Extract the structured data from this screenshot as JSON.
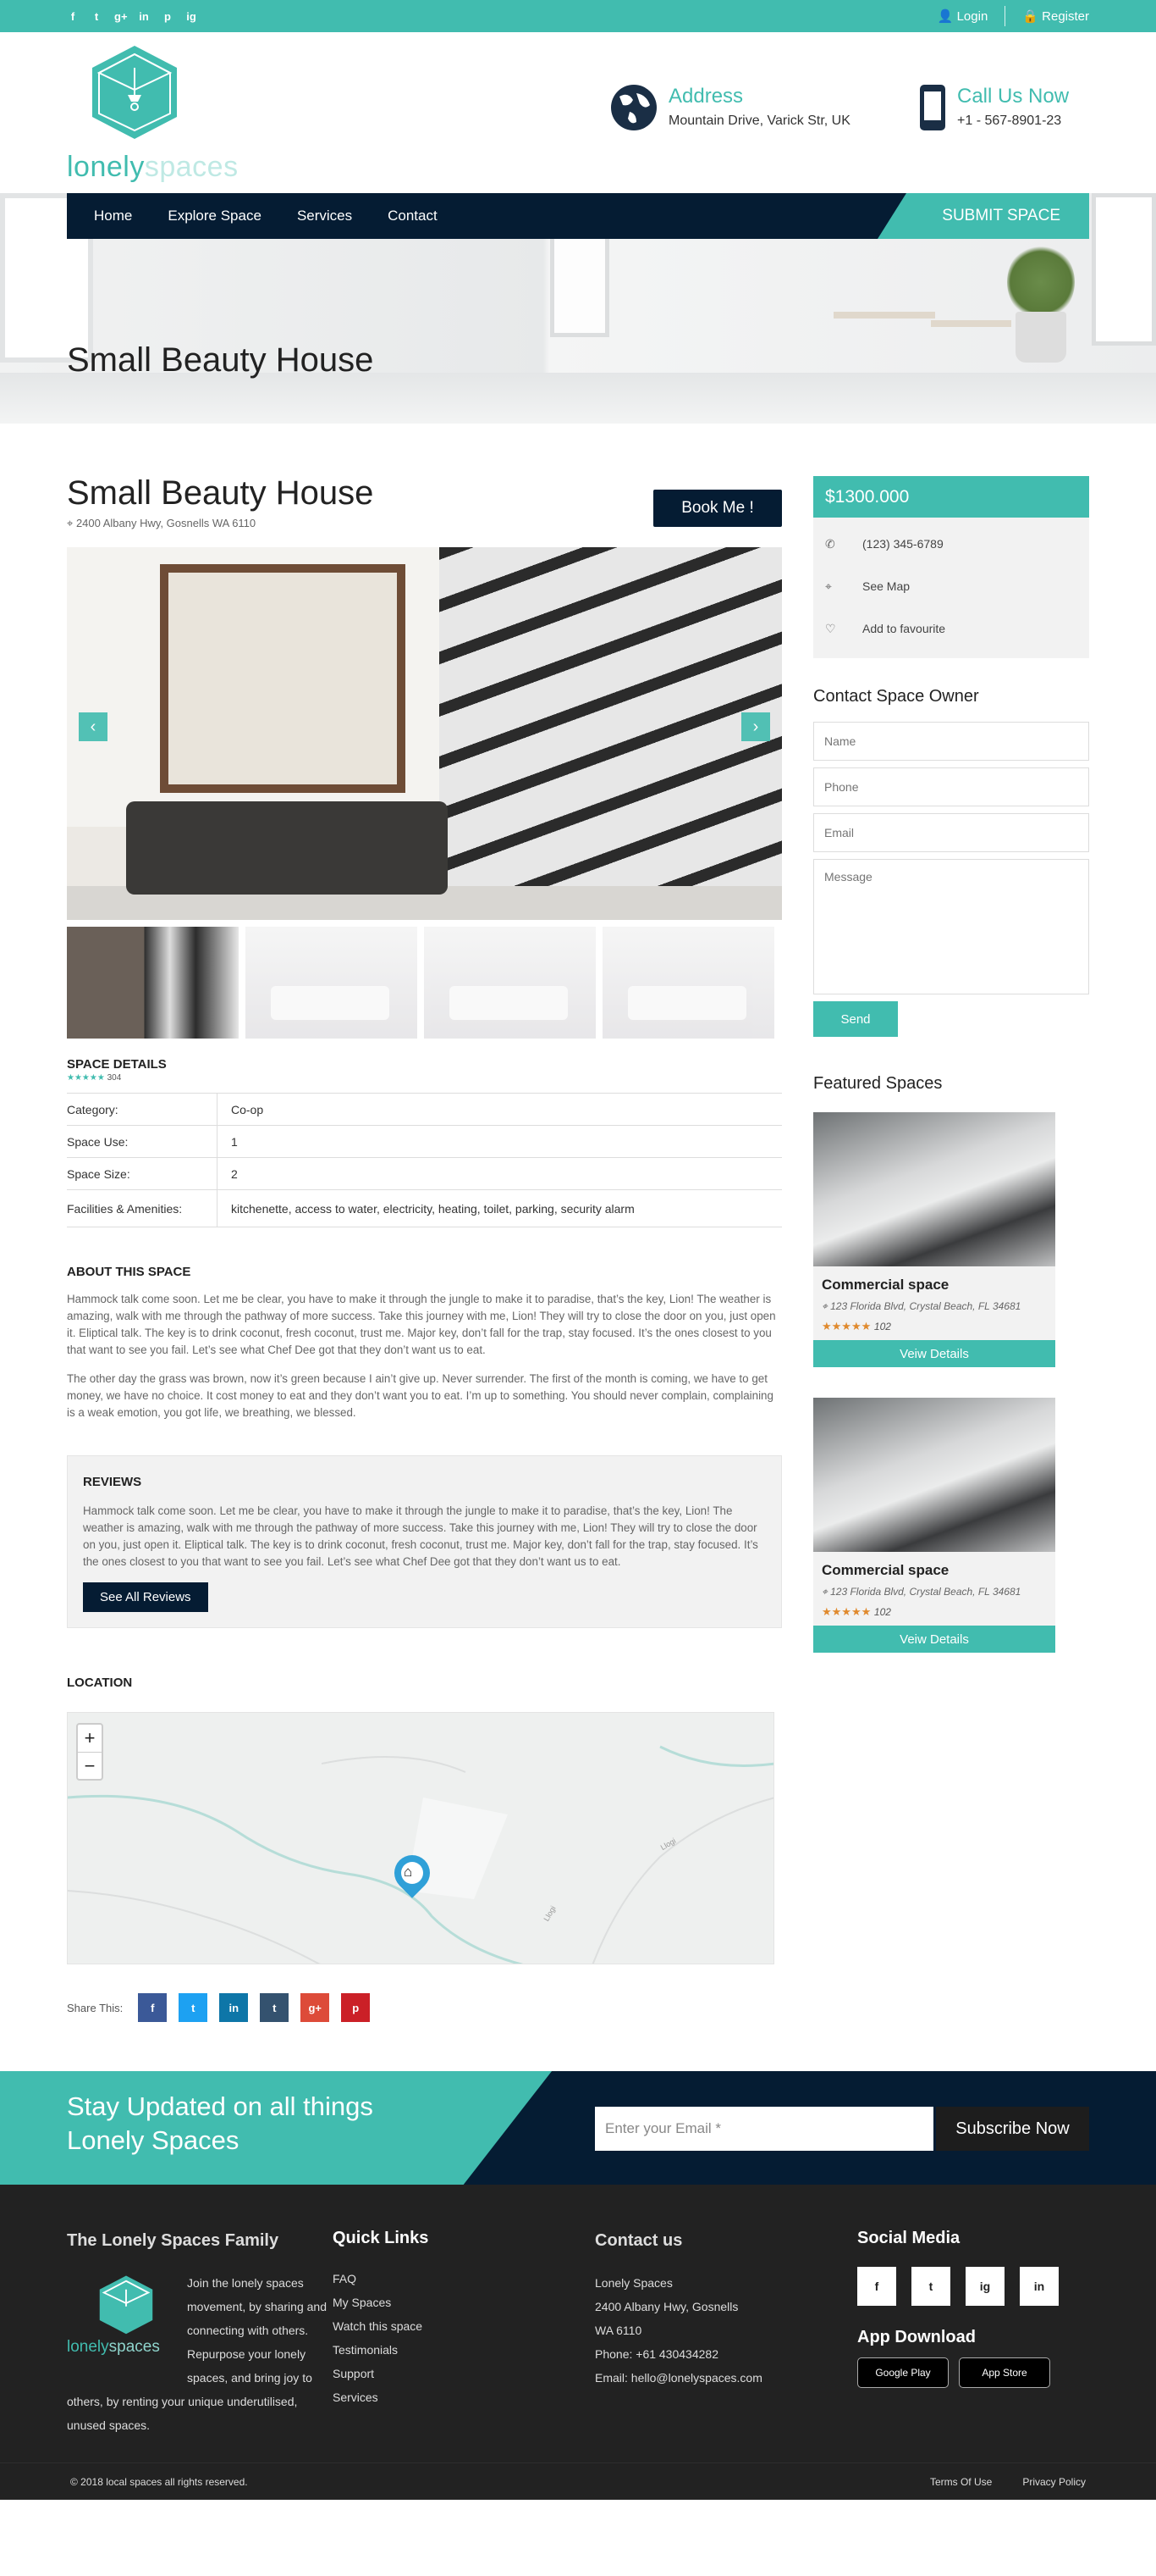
{
  "topbar": {
    "social": [
      "f",
      "t",
      "g+",
      "in",
      "p",
      "ig"
    ],
    "login": "Login",
    "register": "Register"
  },
  "header": {
    "logo_main": "lonely",
    "logo_accent": "spaces",
    "address_title": "Address",
    "address_value": "Mountain Drive, Varick Str, UK",
    "call_title": "Call Us Now",
    "call_value": "+1 - 567-8901-23"
  },
  "nav": {
    "items": [
      "Home",
      "Explore Space",
      "Services",
      "Contact"
    ],
    "submit": "SUBMIT SPACE"
  },
  "hero": {
    "title": "Small Beauty House"
  },
  "listing": {
    "title": "Small Beauty House",
    "address": "2400 Albany Hwy, Gosnells WA 6110",
    "book": "Book Me !",
    "prev": "‹",
    "next": "›"
  },
  "details": {
    "heading": "SPACE DETAILS",
    "stars": "★★★★★",
    "count": "304",
    "rows": [
      {
        "k": "Category:",
        "v": "Co-op"
      },
      {
        "k": "Space Use:",
        "v": "1"
      },
      {
        "k": "Space Size:",
        "v": "2"
      },
      {
        "k": "Facilities & Amenities:",
        "v": "kitchenette, access to water, electricity, heating, toilet, parking, security alarm"
      }
    ]
  },
  "about": {
    "heading": "ABOUT THIS SPACE",
    "p1": "Hammock talk come soon. Let me be clear, you have to make it through the jungle to make it to paradise, that’s the key, Lion! The weather is amazing, walk with me through the pathway of more success. Take this journey with me, Lion! They will try to close the door on you, just open it. Eliptical talk. The key is to drink coconut, fresh coconut, trust me. Major key, don’t fall for the trap, stay focused. It’s the ones closest to you that want to see you fail. Let’s see what Chef Dee got that they don’t want us to eat.",
    "p2": "The other day the grass was brown, now it’s green because I ain’t give up. Never surrender. The first of the month is coming, we have to get money, we have no choice. It cost money to eat and they don’t want you to eat. I’m up to something. You should never complain, complaining is a weak emotion, you got life, we breathing, we blessed."
  },
  "reviews": {
    "heading": "REVIEWS",
    "text": "Hammock talk come soon. Let me be clear, you have to make it through the jungle to make it to paradise, that’s the key, Lion! The weather is amazing, walk with me through the pathway of more success. Take this journey with me, Lion! They will try to close the door on you, just open it. Eliptical talk. The key is to drink coconut, fresh coconut, trust me. Major key, don’t fall for the trap, stay focused. It’s the ones closest to you that want to see you fail. Let’s see what Chef Dee got that they don’t want us to eat.",
    "button": "See All Reviews"
  },
  "location": {
    "heading": "LOCATION",
    "zoom_in": "+",
    "zoom_out": "−",
    "road1": "Llogi",
    "road2": "Llogi"
  },
  "share": {
    "label": "Share This:",
    "icons": [
      "f",
      "t",
      "in",
      "t",
      "g+",
      "p"
    ]
  },
  "sidebar": {
    "price": "$1300.000",
    "phone": "(123) 345-6789",
    "map": "See Map",
    "fav": "Add to favourite",
    "contact_heading": "Contact Space Owner",
    "name_ph": "Name",
    "phone_ph": "Phone",
    "email_ph": "Email",
    "message_ph": "Message",
    "send": "Send",
    "featured_heading": "Featured Spaces",
    "cards": [
      {
        "name": "Commercial space",
        "address": "123 Florida Blvd, Crystal Beach, FL 34681",
        "stars": "★★★★★",
        "count": "102",
        "button": "Veiw Details"
      },
      {
        "name": "Commercial space",
        "address": "123 Florida Blvd, Crystal Beach, FL 34681",
        "stars": "★★★★★",
        "count": "102",
        "button": "Veiw Details"
      }
    ]
  },
  "newsletter": {
    "title": "Stay Updated on all things Lonely Spaces",
    "placeholder": "Enter your Email *",
    "button": "Subscribe Now"
  },
  "footer": {
    "family_heading": "The Lonely Spaces Family",
    "family_text": "Join the lonely spaces movement, by sharing and connecting with others. Repurpose your lonely spaces, and bring joy to others, by renting your unique underutilised, unused spaces.",
    "links_heading": "Quick Links",
    "links": [
      "FAQ",
      "My Spaces",
      "Watch this space",
      "Testimonials",
      "Support",
      "Services"
    ],
    "contact_heading": "Contact us",
    "contact_lines": [
      "Lonely Spaces",
      "2400 Albany Hwy, Gosnells",
      "WA 6110",
      "Phone: +61 430434282",
      "Email: hello@lonelyspaces.com"
    ],
    "social_heading": "Social Media",
    "social": [
      "f",
      "t",
      "ig",
      "in"
    ],
    "app_heading": "App Download",
    "google": "Google Play",
    "apple": "App Store",
    "copyright": "© 2018 local spaces all rights reserved.",
    "terms": "Terms Of Use",
    "privacy": "Privacy Policy"
  }
}
